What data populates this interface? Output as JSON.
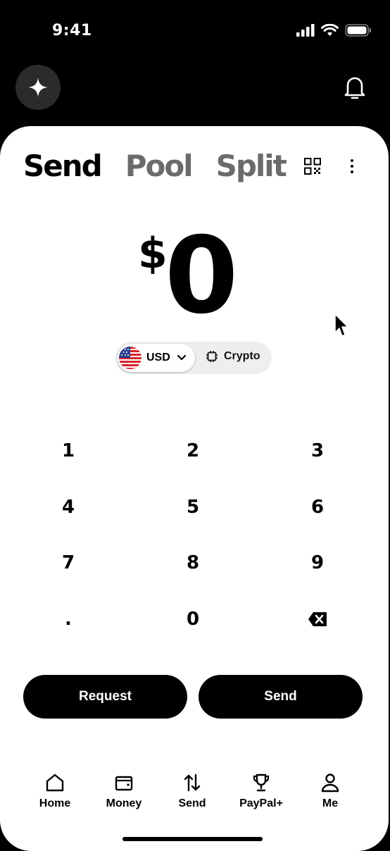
{
  "status_bar": {
    "time": "9:41"
  },
  "header": {
    "icons": [
      "sparkle-icon",
      "bell-icon"
    ]
  },
  "tabs": [
    {
      "label": "Send",
      "active": true
    },
    {
      "label": "Pool",
      "active": false
    },
    {
      "label": "Split",
      "active": false
    }
  ],
  "toolbar_icons": [
    "qr-code-icon",
    "more-vertical-icon"
  ],
  "amount": {
    "symbol": "$",
    "value": "0"
  },
  "currency_toggle": {
    "selected": "USD",
    "other": "Crypto"
  },
  "keypad": {
    "keys": [
      "1",
      "2",
      "3",
      "4",
      "5",
      "6",
      "7",
      "8",
      "9",
      ".",
      "0"
    ],
    "backspace_icon": "backspace-icon"
  },
  "actions": {
    "request_label": "Request",
    "send_label": "Send"
  },
  "nav": {
    "items": [
      {
        "label": "Home",
        "icon": "home-icon"
      },
      {
        "label": "Money",
        "icon": "wallet-icon"
      },
      {
        "label": "Send",
        "icon": "transfer-arrows-icon"
      },
      {
        "label": "PayPal+",
        "icon": "trophy-icon"
      },
      {
        "label": "Me",
        "icon": "user-icon"
      }
    ]
  },
  "colors": {
    "background": "#000000",
    "card": "#ffffff",
    "inactive_tab": "#6b6b6b",
    "toggle_bg": "#eceef0"
  }
}
